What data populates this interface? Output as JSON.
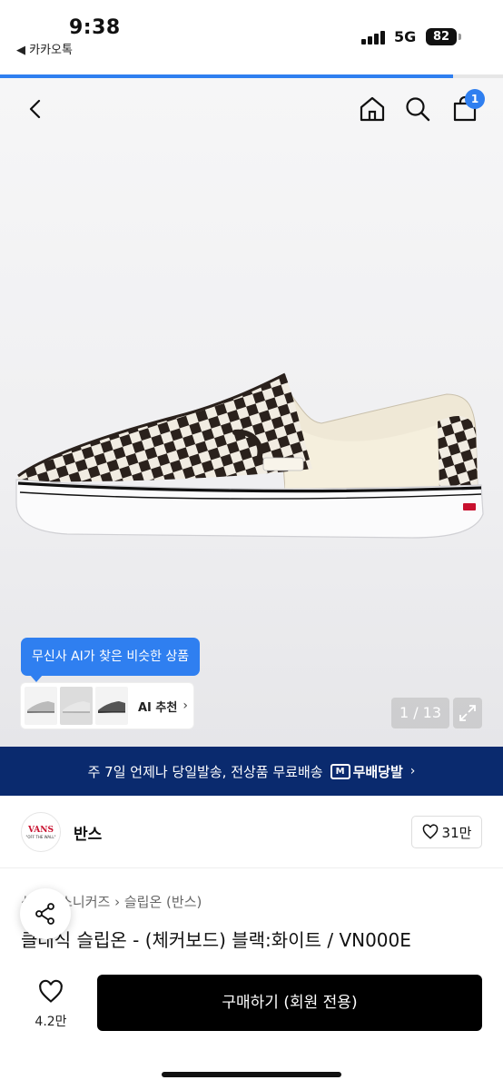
{
  "status_bar": {
    "time": "9:38",
    "back_app": "◀ 카카오톡",
    "network": "5G",
    "battery": "82"
  },
  "page_progress": 0.9,
  "nav": {
    "back_icon": "chevron-left-icon",
    "home_icon": "home-icon",
    "search_icon": "search-icon",
    "cart_icon": "cart-icon",
    "cart_badge": "1"
  },
  "hero": {
    "ai_tooltip": "무신사 AI가 찾은 비슷한 상품",
    "ai_label": "AI 추천",
    "ai_chevron": "›",
    "pager": "1 / 13",
    "expand_icon": "expand-icon"
  },
  "banner": {
    "text": "주 7일 언제나 당일발송, 전상품 무료배송",
    "logo_mark": "M",
    "brand": "무배당발",
    "chevron": "›"
  },
  "brand": {
    "logo_text": "VANS",
    "logo_sub": "\"OFF THE WALL\"",
    "name": "반스",
    "likes": "31만"
  },
  "product": {
    "breadcrumb": "신발 › 스니커즈 › 슬립온 (반스)",
    "title": "클래식 슬립온 - (체커보드) 블랙:화이트 / VN000E"
  },
  "bottom_bar": {
    "wish_count": "4.2만",
    "buy_label": "구매하기 (회원 전용)"
  },
  "colors": {
    "accent": "#2f7ff0",
    "banner_bg": "#0a2a6e",
    "buy_bg": "#000000"
  }
}
